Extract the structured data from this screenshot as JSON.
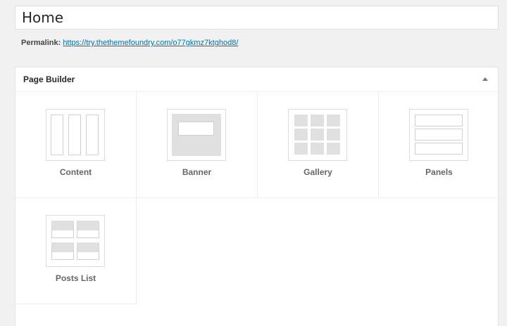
{
  "page": {
    "title_value": "Home",
    "permalink_label": "Permalink:",
    "permalink_url": "https://try.thethemefoundry.com/o77gkmz7ktghod8/"
  },
  "page_builder": {
    "title": "Page Builder",
    "tiles": [
      {
        "label": "Content"
      },
      {
        "label": "Banner"
      },
      {
        "label": "Gallery"
      },
      {
        "label": "Panels"
      },
      {
        "label": "Posts List"
      }
    ]
  },
  "colors": {
    "link": "#0073aa",
    "placeholder_fill": "#e0e0e0",
    "border": "#dcdcdc"
  }
}
